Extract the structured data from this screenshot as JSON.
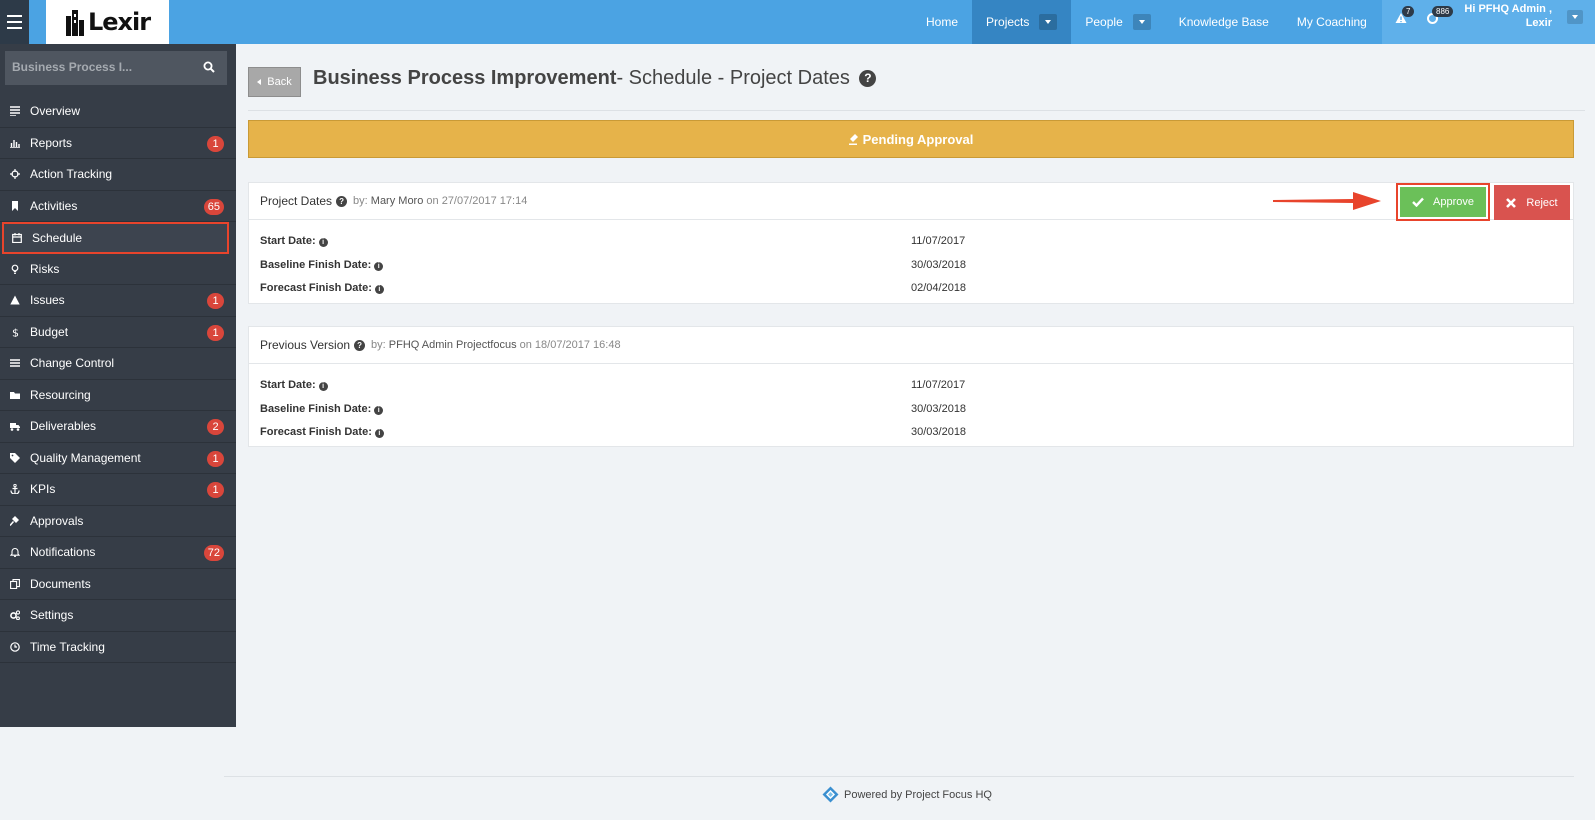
{
  "app": {
    "logo_text": "Lexir"
  },
  "topnav": {
    "items": [
      {
        "label": "Home"
      },
      {
        "label": "Projects"
      },
      {
        "label": "People"
      },
      {
        "label": "Knowledge Base"
      },
      {
        "label": "My Coaching"
      }
    ],
    "alerts_count": "7",
    "approvals_count": "886",
    "user_greeting_line1": "Hi PFHQ Admin ,",
    "user_greeting_line2": "Lexir"
  },
  "sidebar": {
    "search_value": "Business Process I...",
    "items": [
      {
        "label": "Overview",
        "icon": "list-icon",
        "badge": ""
      },
      {
        "label": "Reports",
        "icon": "bar-chart-icon",
        "badge": "1"
      },
      {
        "label": "Action Tracking",
        "icon": "crosshair-icon",
        "badge": ""
      },
      {
        "label": "Activities",
        "icon": "bookmark-icon",
        "badge": "65"
      },
      {
        "label": "Schedule",
        "icon": "calendar-icon",
        "badge": ""
      },
      {
        "label": "Risks",
        "icon": "lightbulb-icon",
        "badge": ""
      },
      {
        "label": "Issues",
        "icon": "warning-icon",
        "badge": "1"
      },
      {
        "label": "Budget",
        "icon": "dollar-icon",
        "badge": "1"
      },
      {
        "label": "Change Control",
        "icon": "lines-icon",
        "badge": ""
      },
      {
        "label": "Resourcing",
        "icon": "folder-icon",
        "badge": ""
      },
      {
        "label": "Deliverables",
        "icon": "truck-icon",
        "badge": "2"
      },
      {
        "label": "Quality Management",
        "icon": "tag-icon",
        "badge": "1"
      },
      {
        "label": "KPIs",
        "icon": "anchor-icon",
        "badge": "1"
      },
      {
        "label": "Approvals",
        "icon": "gavel-icon",
        "badge": ""
      },
      {
        "label": "Notifications",
        "icon": "bell-icon",
        "badge": "72"
      },
      {
        "label": "Documents",
        "icon": "copy-icon",
        "badge": ""
      },
      {
        "label": "Settings",
        "icon": "cogs-icon",
        "badge": ""
      },
      {
        "label": "Time Tracking",
        "icon": "clock-icon",
        "badge": ""
      }
    ]
  },
  "main": {
    "back_label": "Back",
    "title_bold": "Business Process Improvement",
    "title_rest": "- Schedule - Project Dates",
    "pending_label": "Pending Approval",
    "approve_label": "Approve",
    "reject_label": "Reject",
    "current": {
      "title": "Project Dates",
      "by_label": "by:",
      "author": "Mary Moro",
      "on_label": "on 27/07/2017 17:14",
      "rows": [
        {
          "label": "Start Date:",
          "value": "11/07/2017"
        },
        {
          "label": "Baseline Finish Date:",
          "value": "30/03/2018"
        },
        {
          "label": "Forecast Finish Date:",
          "value": "02/04/2018"
        }
      ]
    },
    "previous": {
      "title": "Previous Version",
      "by_label": "by:",
      "author": "PFHQ Admin Projectfocus",
      "on_label": "on 18/07/2017 16:48",
      "rows": [
        {
          "label": "Start Date:",
          "value": "11/07/2017"
        },
        {
          "label": "Baseline Finish Date:",
          "value": "30/03/2018"
        },
        {
          "label": "Forecast Finish Date:",
          "value": "30/03/2018"
        }
      ]
    }
  },
  "footer": {
    "text": "Powered by Project Focus HQ"
  },
  "colors": {
    "nav_blue": "#4ba3e3",
    "sidebar_dark": "#363d47",
    "pending_yellow": "#e6b34a",
    "approve_green": "#6bc059",
    "reject_red": "#d9534f",
    "highlight_red": "#e8442c"
  }
}
